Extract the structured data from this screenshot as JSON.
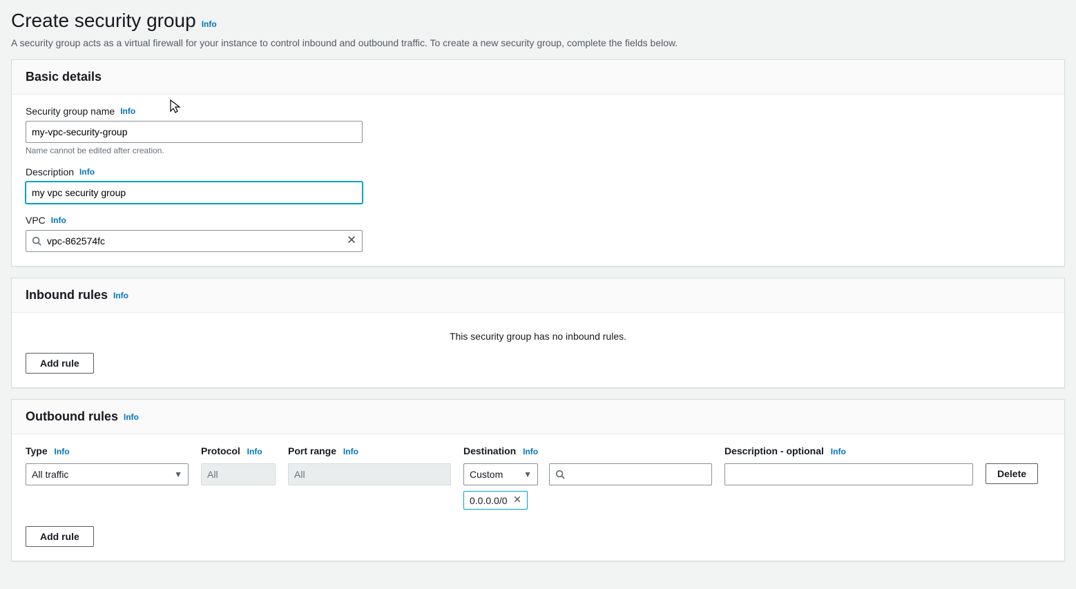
{
  "page": {
    "title": "Create security group",
    "info": "Info",
    "description": "A security group acts as a virtual firewall for your instance to control inbound and outbound traffic. To create a new security group, complete the fields below."
  },
  "basic": {
    "heading": "Basic details",
    "name_label": "Security group name",
    "name_info": "Info",
    "name_value": "my-vpc-security-group",
    "name_help": "Name cannot be edited after creation.",
    "desc_label": "Description",
    "desc_info": "Info",
    "desc_value": "my vpc security group",
    "vpc_label": "VPC",
    "vpc_info": "Info",
    "vpc_value": "vpc-862574fc"
  },
  "inbound": {
    "heading": "Inbound rules",
    "info": "Info",
    "empty_msg": "This security group has no inbound rules.",
    "add_rule": "Add rule"
  },
  "outbound": {
    "heading": "Outbound rules",
    "info": "Info",
    "columns": {
      "type": "Type",
      "type_info": "Info",
      "protocol": "Protocol",
      "protocol_info": "Info",
      "port": "Port range",
      "port_info": "Info",
      "destination": "Destination",
      "destination_info": "Info",
      "desc": "Description - optional",
      "desc_info": "Info"
    },
    "row": {
      "type_value": "All traffic",
      "protocol_value": "All",
      "port_value": "All",
      "dest_mode": "Custom",
      "dest_chip": "0.0.0.0/0",
      "desc_value": ""
    },
    "delete": "Delete",
    "add_rule": "Add rule"
  }
}
